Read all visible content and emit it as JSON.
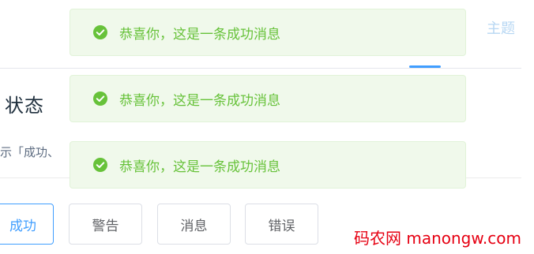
{
  "header": {
    "theme_link": "主题"
  },
  "section": {
    "heading": "状态",
    "description": "示「成功、"
  },
  "buttons": {
    "success": "成功",
    "warning": "警告",
    "info": "消息",
    "error": "错误"
  },
  "messages": [
    {
      "text": "恭喜你，这是一条成功消息",
      "icon": "success-check-circle-icon"
    },
    {
      "text": "恭喜你，这是一条成功消息",
      "icon": "success-check-circle-icon"
    },
    {
      "text": "恭喜你，这是一条成功消息",
      "icon": "success-check-circle-icon"
    }
  ],
  "watermark": "码农网 manongw.com",
  "colors": {
    "success_text": "#67c23a",
    "success_bg": "#f0f9eb",
    "success_border": "#e1f3d8",
    "primary": "#409eff",
    "watermark": "#e60012"
  }
}
